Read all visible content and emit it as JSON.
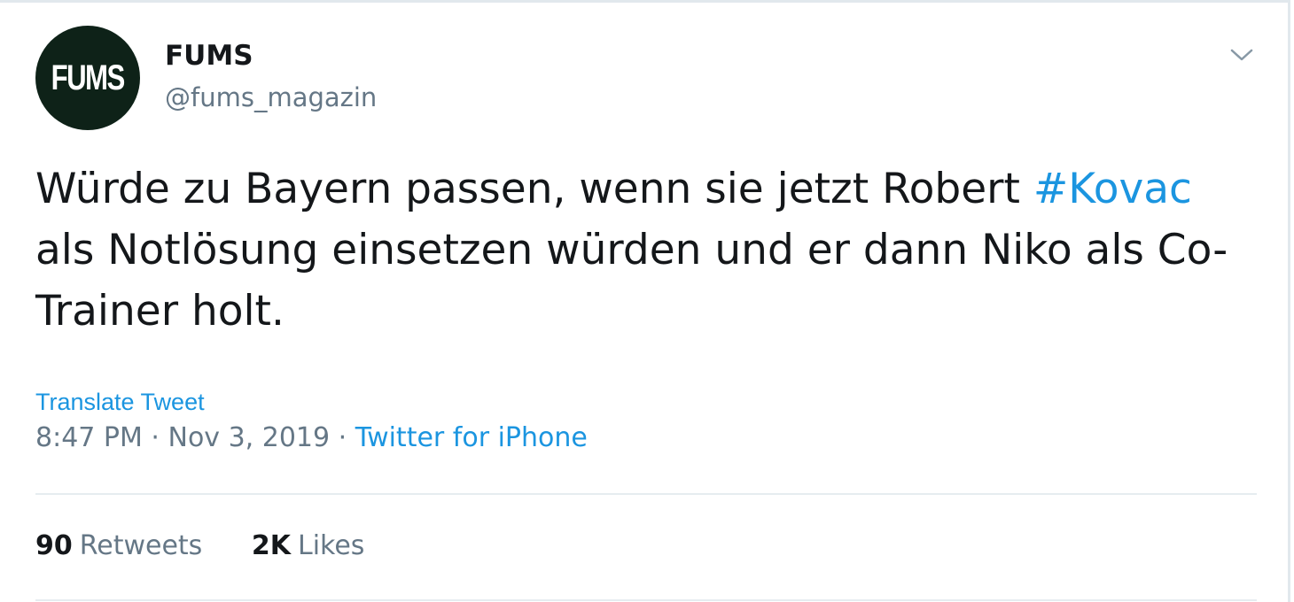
{
  "author": {
    "display_name": "FUMS",
    "handle": "@fums_magazin",
    "avatar_text": "FUMS"
  },
  "tweet": {
    "text_before": "Würde zu Bayern passen, wenn sie jetzt Robert ",
    "hashtag": "#Kovac",
    "text_after": " als Notlösung einsetzen würden und er dann Niko als Co-Trainer holt.",
    "translate_label": "Translate Tweet",
    "time": "8:47 PM",
    "separator": " · ",
    "date": "Nov 3, 2019",
    "source": "Twitter for iPhone"
  },
  "stats": {
    "retweets_count": "90",
    "retweets_label": "Retweets",
    "likes_count": "2K",
    "likes_label": "Likes"
  },
  "icons": {
    "caret": "chevron-down-icon"
  },
  "colors": {
    "link": "#1b95e0",
    "secondary_text": "#657786",
    "primary_text": "#14171a",
    "avatar_bg": "#0e2218"
  }
}
